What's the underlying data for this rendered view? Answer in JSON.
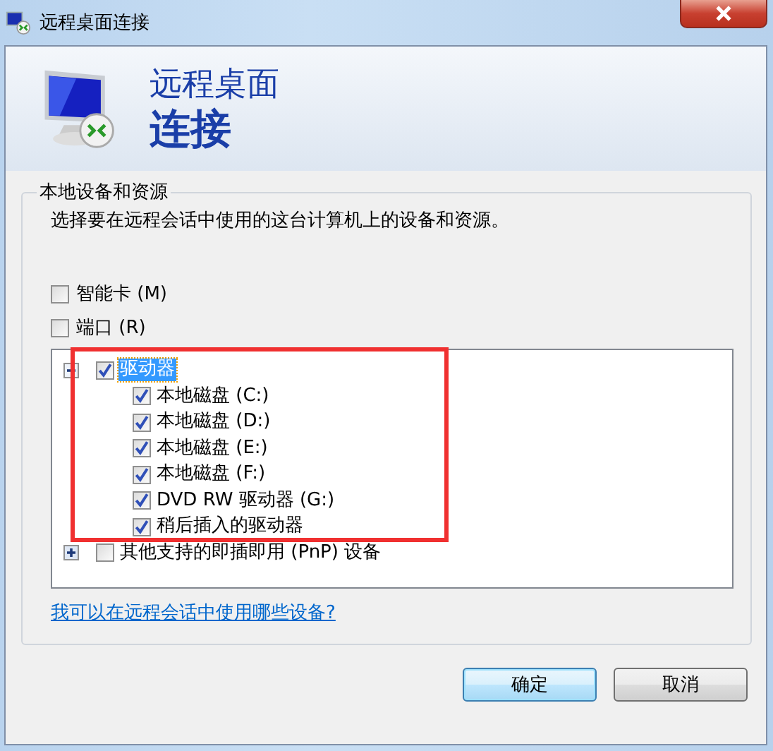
{
  "window": {
    "title": "远程桌面连接"
  },
  "header": {
    "line_1": "远程桌面",
    "line_2": "连接"
  },
  "group": {
    "legend": "本地设备和资源",
    "description": "选择要在远程会话中使用的这台计算机上的设备和资源。",
    "checkboxes": [
      {
        "label": "智能卡 (M)",
        "checked": false
      },
      {
        "label": "端口 (R)",
        "checked": false
      }
    ],
    "tree": [
      {
        "label": "驱动器",
        "checked": true,
        "expanded": true,
        "selected": true,
        "children": [
          {
            "label": "本地磁盘 (C:)",
            "checked": true
          },
          {
            "label": "本地磁盘 (D:)",
            "checked": true
          },
          {
            "label": "本地磁盘 (E:)",
            "checked": true
          },
          {
            "label": "本地磁盘 (F:)",
            "checked": true
          },
          {
            "label": "DVD RW 驱动器 (G:)",
            "checked": true
          },
          {
            "label": "稍后插入的驱动器",
            "checked": true
          }
        ]
      },
      {
        "label": "其他支持的即插即用 (PnP) 设备",
        "checked": false,
        "expanded": false,
        "selected": false
      }
    ],
    "help_link": "我可以在远程会话中使用哪些设备?"
  },
  "buttons": [
    {
      "label": "确定",
      "default": true
    },
    {
      "label": "取消",
      "default": false
    }
  ]
}
